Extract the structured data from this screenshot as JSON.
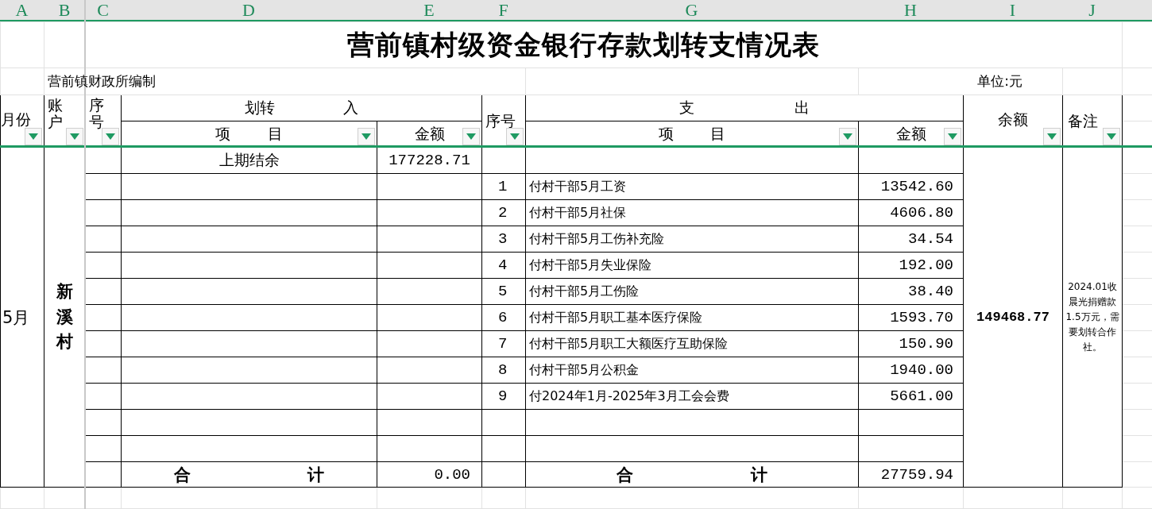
{
  "columns": [
    "A",
    "B",
    "C",
    "D",
    "E",
    "F",
    "G",
    "H",
    "I",
    "J"
  ],
  "title": "营前镇村级资金银行存款划转支情况表",
  "compiled_by": "营前镇财政所编制",
  "unit": "单位:元",
  "headers": {
    "month": "月份",
    "account": "账户",
    "seq_in": "序号",
    "transfer_in": "划转 入",
    "in_item": "项 目",
    "in_amount": "金额",
    "seq_out": "序号",
    "expense": "支 出",
    "out_item": "项 目",
    "out_amount": "金额",
    "balance": "余额",
    "remark": "备注"
  },
  "month": "5月",
  "account": "新溪村",
  "rows": [
    {
      "in_item": "上期结余",
      "in_amount": "177228.71"
    },
    {
      "out_seq": "1",
      "out_item": "付村干部5月工资",
      "out_amount": "13542.60"
    },
    {
      "out_seq": "2",
      "out_item": "付村干部5月社保",
      "out_amount": "4606.80"
    },
    {
      "out_seq": "3",
      "out_item": "付村干部5月工伤补充险",
      "out_amount": "34.54"
    },
    {
      "out_seq": "4",
      "out_item": "付村干部5月失业保险",
      "out_amount": "192.00"
    },
    {
      "out_seq": "5",
      "out_item": "付村干部5月工伤险",
      "out_amount": "38.40"
    },
    {
      "out_seq": "6",
      "out_item": "付村干部5月职工基本医疗保险",
      "out_amount": "1593.70"
    },
    {
      "out_seq": "7",
      "out_item": "付村干部5月职工大额医疗互助保险",
      "out_amount": "150.90"
    },
    {
      "out_seq": "8",
      "out_item": "付村干部5月公积金",
      "out_amount": "1940.00"
    },
    {
      "out_seq": "9",
      "out_item": "付2024年1月-2025年3月工会会费",
      "out_amount": "5661.00"
    },
    {},
    {}
  ],
  "total": {
    "in_label": "合 计",
    "in_amount": "0.00",
    "out_label": "合 计",
    "out_amount": "27759.94"
  },
  "balance": "149468.77",
  "remark": "2024.01收晨光捐赠款1.5万元，需要划转合作社。"
}
